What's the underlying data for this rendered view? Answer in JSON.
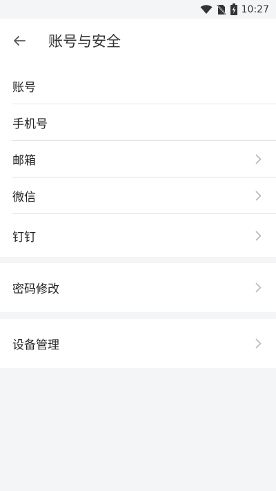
{
  "status": {
    "time": "10:27"
  },
  "header": {
    "title": "账号与安全"
  },
  "group1": [
    {
      "label": "账号",
      "chevron": false
    },
    {
      "label": "手机号",
      "chevron": false
    },
    {
      "label": "邮箱",
      "chevron": true
    },
    {
      "label": "微信",
      "chevron": true
    },
    {
      "label": "钉钉",
      "chevron": true
    }
  ],
  "group2": {
    "label": "密码修改"
  },
  "group3": {
    "label": "设备管理"
  },
  "colors": {
    "background": "#f4f5f7",
    "surface": "#ffffff",
    "divider": "#e3e3e3",
    "chevron": "#b8b8b8"
  }
}
